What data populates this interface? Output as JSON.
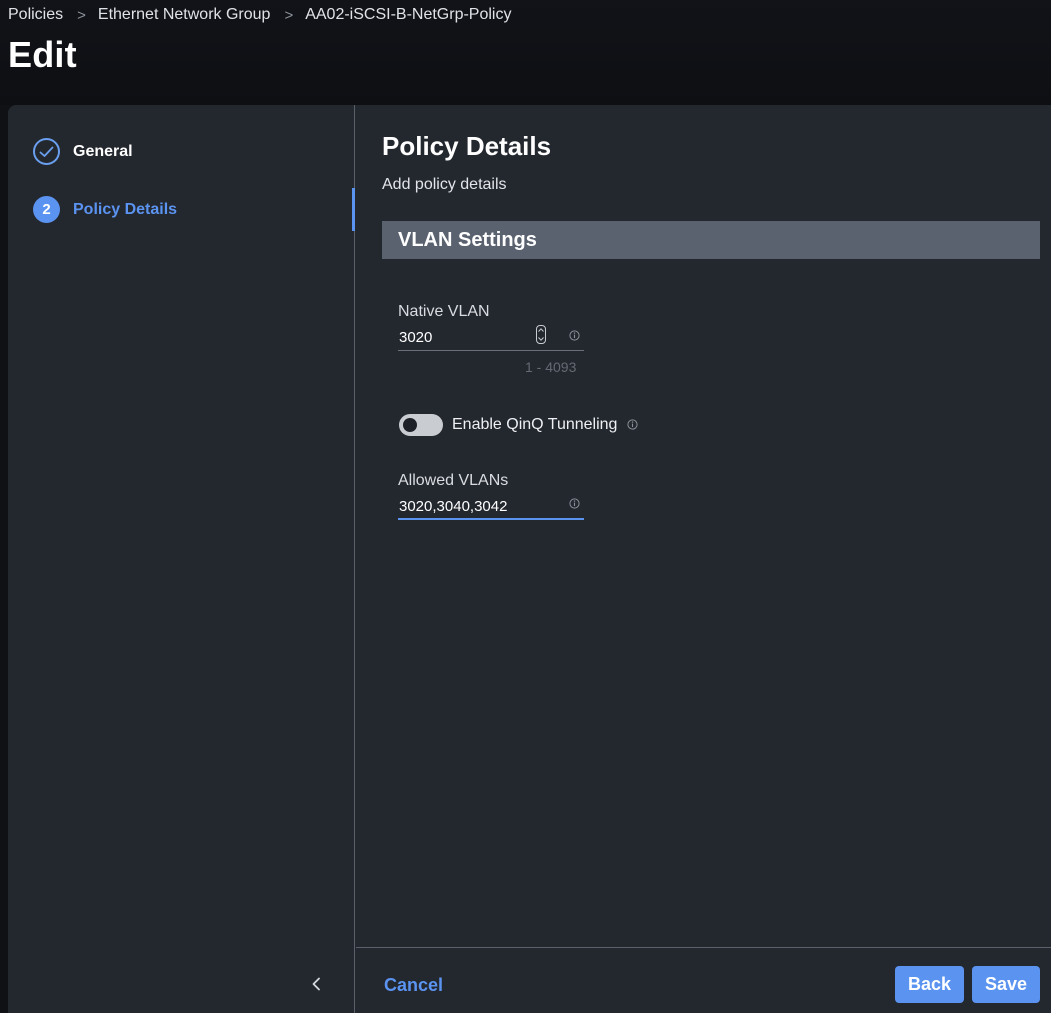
{
  "breadcrumb": {
    "items": [
      "Policies",
      "Ethernet Network Group",
      "AA02-iSCSI-B-NetGrp-Policy"
    ],
    "separator": ">"
  },
  "page": {
    "title": "Edit"
  },
  "wizard": {
    "steps": [
      {
        "label": "General",
        "state": "completed",
        "icon": "check-icon"
      },
      {
        "label": "Policy Details",
        "state": "active",
        "number": "2"
      }
    ],
    "collapse_icon": "chevron-left-icon"
  },
  "content": {
    "title": "Policy Details",
    "subtitle": "Add policy details",
    "section_header": "VLAN Settings",
    "native_vlan": {
      "label": "Native VLAN",
      "value": "3020",
      "range_hint": "1 - 4093"
    },
    "qinq": {
      "label": "Enable QinQ Tunneling",
      "enabled": false
    },
    "allowed_vlans": {
      "label": "Allowed VLANs",
      "value": "3020,3040,3042"
    }
  },
  "footer": {
    "cancel_label": "Cancel",
    "back_label": "Back",
    "save_label": "Save"
  },
  "colors": {
    "accent": "#5b93f0",
    "panel_bg": "#23272e",
    "section_header_bg": "#5a6270",
    "page_bg": "#0f1115"
  }
}
